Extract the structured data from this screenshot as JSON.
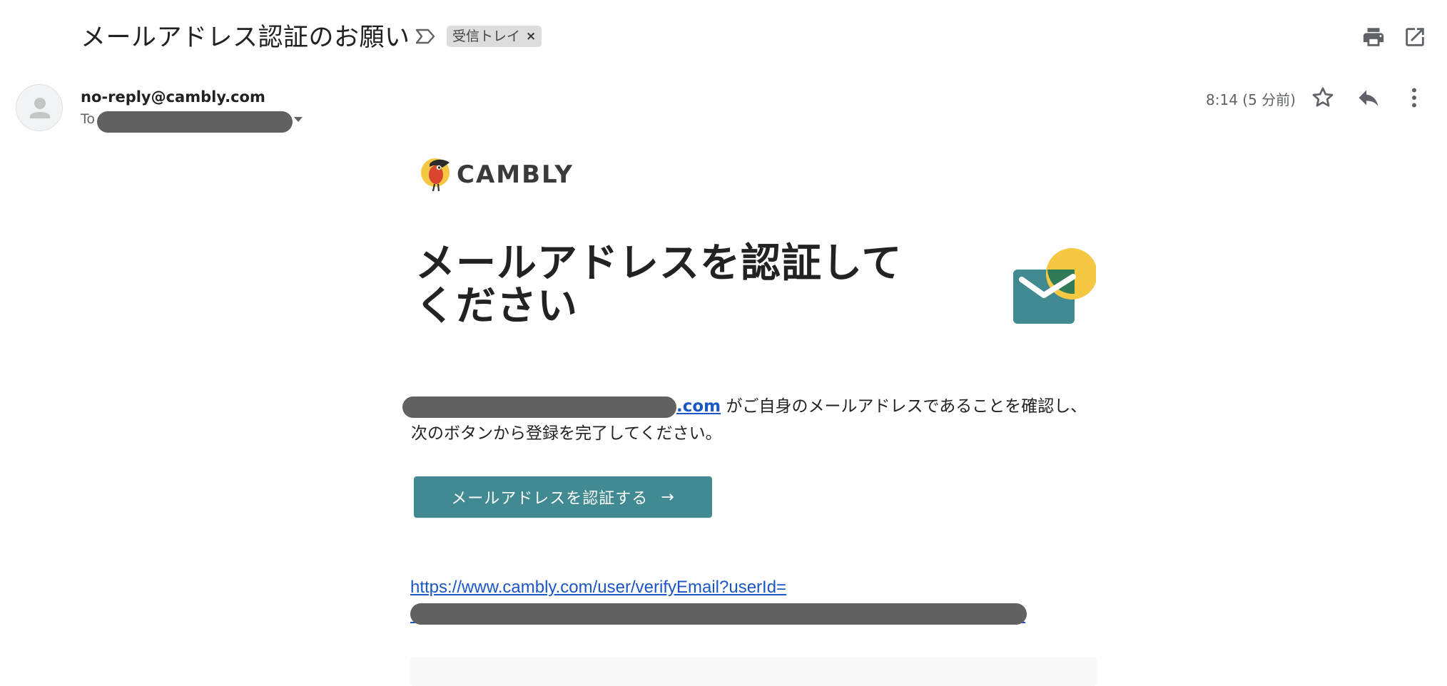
{
  "email": {
    "subject": "メールアドレス認証のお願い",
    "label_chip": "受信トレイ",
    "label_chip_close": "×",
    "sender": "no-reply@cambly.com",
    "to_label": "To",
    "time": "8:14 (5 分前)"
  },
  "icons": {
    "important": "label-important-icon",
    "print": "print-icon",
    "open_new": "open-in-new-window-icon",
    "star": "star-icon",
    "reply": "reply-icon",
    "more": "more-vert-icon",
    "caret": "caret-down-icon",
    "arrow": "arrow-right-icon"
  },
  "content": {
    "logo_text": "CAMBLY",
    "hero_title": "メールアドレスを認証してください",
    "email_link_suffix": ".com",
    "body_text": " がご自身のメールアドレスであることを確認し、次のボタンから登録を完了してください。",
    "cta_label": "メールアドレスを認証する",
    "cta_arrow": "→",
    "verify_url": "https://www.cambly.com/user/verifyEmail?userId="
  },
  "colors": {
    "brand_teal": "#428a91",
    "link_blue": "#1a56c4",
    "accent_yellow": "#f6c743",
    "redaction": "#616161"
  }
}
